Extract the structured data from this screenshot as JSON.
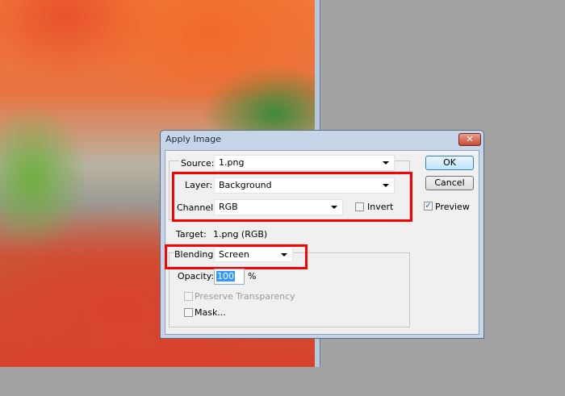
{
  "dialog": {
    "title": "Apply Image",
    "close_label": "✕"
  },
  "source": {
    "label": "Source:",
    "value": "1.png"
  },
  "layer": {
    "label": "Layer:",
    "value": "Background"
  },
  "channel": {
    "label": "Channel:",
    "value": "RGB"
  },
  "invert": {
    "label": "Invert",
    "checked": false
  },
  "target": {
    "label": "Target:",
    "value": "1.png (RGB)"
  },
  "blending": {
    "label": "Blending:",
    "value": "Screen"
  },
  "opacity": {
    "label": "Opacity:",
    "value": "100",
    "unit": "%"
  },
  "preserve_transparency": {
    "label": "Preserve Transparency",
    "checked": false,
    "disabled": true
  },
  "mask": {
    "label": "Mask...",
    "checked": false
  },
  "buttons": {
    "ok": "OK",
    "cancel": "Cancel"
  },
  "preview": {
    "label": "Preview",
    "checked": true,
    "mark": "✓"
  },
  "colors": {
    "highlight": "#ff0000"
  }
}
